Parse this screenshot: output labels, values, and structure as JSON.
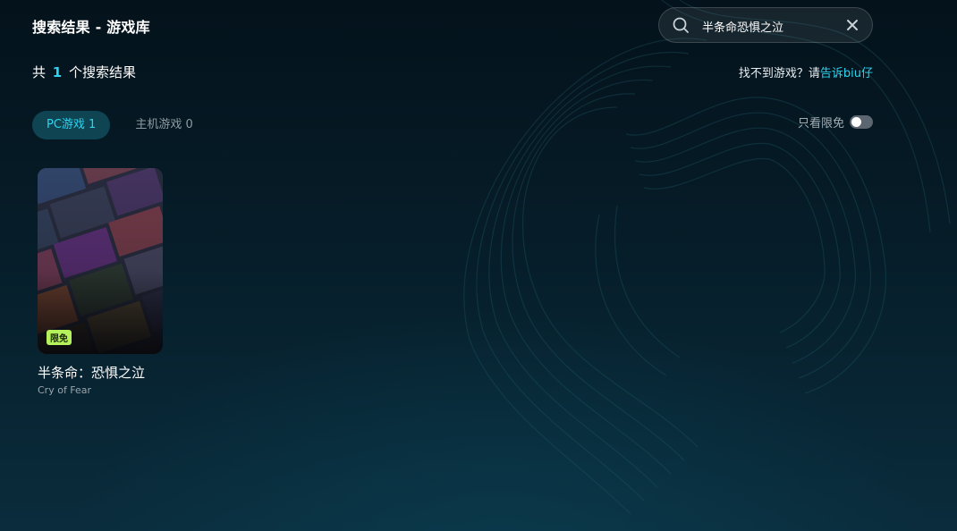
{
  "header": {
    "title": "搜索结果 - 游戏库"
  },
  "search": {
    "value": "半条命恐惧之泣",
    "icon": "search-icon",
    "clear_icon": "close-icon"
  },
  "results": {
    "prefix": "共",
    "count": "1",
    "suffix": "个搜索结果",
    "feedback_text": "找不到游戏？请",
    "feedback_link": "告诉biu仔"
  },
  "tabs": [
    {
      "label": "PC游戏 1",
      "active": true
    },
    {
      "label": "主机游戏 0",
      "active": false
    }
  ],
  "filter": {
    "label": "只看限免",
    "enabled": false
  },
  "games": [
    {
      "name": "半条命：恐惧之泣",
      "subname": "Cry of Fear",
      "badge": "限免"
    }
  ],
  "colors": {
    "accent": "#2cd4f0",
    "badge": "#b4f15a",
    "tab_active_bg": "#0f4453"
  }
}
